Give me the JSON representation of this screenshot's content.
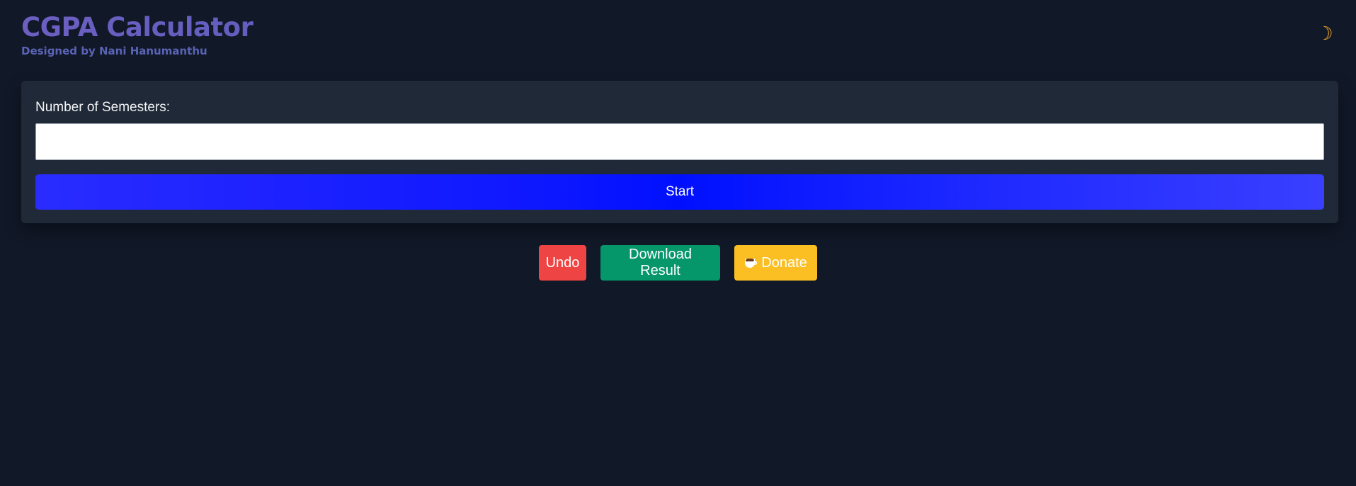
{
  "header": {
    "title": "CGPA Calculator",
    "subtitle": "Designed by Nani Hanumanthu",
    "theme_toggle_icon": "☽",
    "theme_toggle_icon_name": "moon-icon"
  },
  "form": {
    "semesters_label": "Number of Semesters:",
    "semesters_value": "",
    "semesters_placeholder": "",
    "start_label": "Start"
  },
  "actions": {
    "undo_label": "Undo",
    "download_label": "Download Result",
    "donate_label": "Donate",
    "donate_icon_name": "coffee-cup-icon"
  },
  "colors": {
    "background": "#111827",
    "card": "#1f2937",
    "accent_blue": "#0010ff",
    "undo": "#ef4444",
    "download": "#059669",
    "donate": "#fbbf24",
    "moon": "#f5a91f"
  }
}
